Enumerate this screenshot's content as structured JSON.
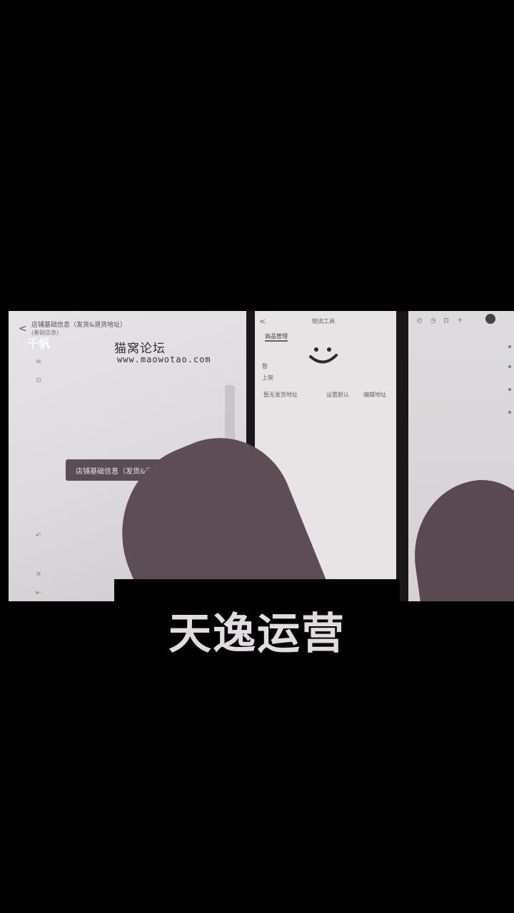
{
  "left_screen": {
    "back_glyph": "<",
    "title": "店铺基础信息（发货&退货地址）",
    "subtitle": "(基础信息)",
    "watermark": "千帆",
    "site_name": "猫窝论坛",
    "site_url": "www.maowotao.com",
    "banner_text": "店铺基础信息（发货&退货&地址",
    "side_icons": [
      "≡",
      "⊙",
      "↶",
      "✕",
      "⇤"
    ]
  },
  "middle_screen": {
    "back_glyph": "<",
    "title": "物流工具",
    "tabs": [
      {
        "label": "商品管理",
        "active": true
      },
      {
        "label": "",
        "active": false
      },
      {
        "label": "",
        "active": false
      }
    ],
    "emoji": "smile",
    "line1": "暂",
    "line2": "上架",
    "row": [
      "暂无发货地址",
      "设置默认",
      "编辑地址"
    ],
    "foot_icon": "⊙"
  },
  "right_screen": {
    "status_icons": "◴ ◷ ⊡ ＋"
  },
  "caption": "天逸运营"
}
